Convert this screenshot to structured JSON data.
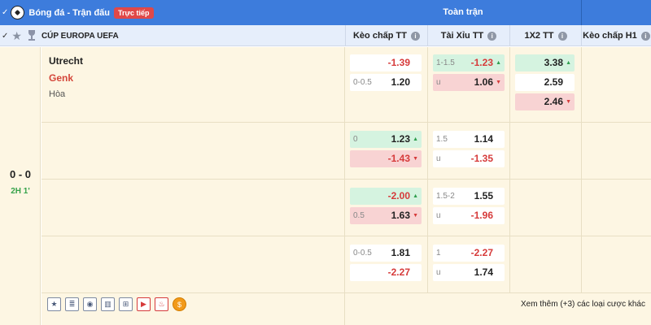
{
  "header": {
    "sport_title": "Bóng đá - Trận đấu",
    "live_badge": "Trực tiếp",
    "fulltime_label": "Toàn trận"
  },
  "league_bar": {
    "league_name": "CÚP EUROPA UEFA",
    "columns": [
      "Kèo chấp TT",
      "Tài Xỉu TT",
      "1X2 TT",
      "Kèo chấp H1"
    ]
  },
  "match": {
    "home": "Utrecht",
    "away": "Genk",
    "draw_label": "Hòa",
    "score": "0 - 0",
    "time": "2H 1'"
  },
  "odds_rows": [
    {
      "handicap": [
        {
          "line": "",
          "value": "-1.39",
          "trend": "none"
        },
        {
          "line": "0-0.5",
          "value": "1.20",
          "trend": "none"
        }
      ],
      "overunder": [
        {
          "line": "1-1.5",
          "value": "-1.23",
          "trend": "up"
        },
        {
          "line": "u",
          "value": "1.06",
          "trend": "down"
        }
      ],
      "x12": [
        {
          "value": "3.38",
          "trend": "up"
        },
        {
          "value": "2.59",
          "trend": "none"
        },
        {
          "value": "2.46",
          "trend": "down"
        }
      ]
    },
    {
      "handicap": [
        {
          "line": "0",
          "value": "1.23",
          "trend": "up"
        },
        {
          "line": "",
          "value": "-1.43",
          "trend": "down"
        }
      ],
      "overunder": [
        {
          "line": "1.5",
          "value": "1.14",
          "trend": "none"
        },
        {
          "line": "u",
          "value": "-1.35",
          "trend": "none"
        }
      ]
    },
    {
      "handicap": [
        {
          "line": "",
          "value": "-2.00",
          "trend": "up"
        },
        {
          "line": "0.5",
          "value": "1.63",
          "trend": "down"
        }
      ],
      "overunder": [
        {
          "line": "1.5-2",
          "value": "1.55",
          "trend": "none"
        },
        {
          "line": "u",
          "value": "-1.96",
          "trend": "none"
        }
      ]
    },
    {
      "handicap": [
        {
          "line": "0-0.5",
          "value": "1.81",
          "trend": "none"
        },
        {
          "line": "",
          "value": "-2.27",
          "trend": "none"
        }
      ],
      "overunder": [
        {
          "line": "1",
          "value": "-2.27",
          "trend": "none"
        },
        {
          "line": "u",
          "value": "1.74",
          "trend": "none"
        }
      ]
    }
  ],
  "footer": {
    "more_label": "Xem thêm (+3) các loại cược khác",
    "icons": [
      "star-icon",
      "database-icon",
      "eye-icon",
      "stats-icon",
      "field-icon",
      "play-icon",
      "fire-icon",
      "promo-icon"
    ]
  },
  "colors": {
    "header_blue": "#3d7cdc",
    "row_bg": "#fdf6e3",
    "up_bg": "#d5f3e0",
    "down_bg": "#f8d3d3",
    "negative": "#d63a3a",
    "away_team": "#d4463a",
    "timer_green": "#35a24a"
  }
}
